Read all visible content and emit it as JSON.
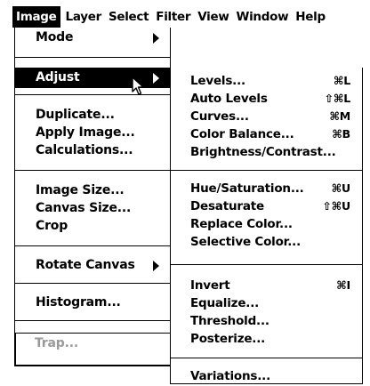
{
  "menubar": {
    "items": [
      "Image",
      "Layer",
      "Select",
      "Filter",
      "View",
      "Window",
      "Help"
    ]
  },
  "image_menu": {
    "mode": "Mode",
    "adjust": "Adjust",
    "duplicate": "Duplicate...",
    "apply_image": "Apply Image...",
    "calculations": "Calculations...",
    "image_size": "Image Size...",
    "canvas_size": "Canvas Size...",
    "crop": "Crop",
    "rotate_canvas": "Rotate Canvas",
    "histogram": "Histogram...",
    "trap": "Trap..."
  },
  "adjust_menu": {
    "levels": "Levels...",
    "levels_sc": "⌘L",
    "auto_levels": "Auto Levels",
    "auto_levels_sc": "⇧⌘L",
    "curves": "Curves...",
    "curves_sc": "⌘M",
    "color_balance": "Color Balance...",
    "color_balance_sc": "⌘B",
    "brightness_contrast": "Brightness/Contrast...",
    "hue_saturation": "Hue/Saturation...",
    "hue_saturation_sc": "⌘U",
    "desaturate": "Desaturate",
    "desaturate_sc": "⇧⌘U",
    "replace_color": "Replace Color...",
    "selective_color": "Selective Color...",
    "invert": "Invert",
    "invert_sc": "⌘I",
    "equalize": "Equalize...",
    "threshold": "Threshold...",
    "posterize": "Posterize...",
    "variations": "Variations..."
  },
  "colors": {
    "highlight_bg": "#000000",
    "highlight_fg": "#ffffff",
    "disabled": "#999999"
  }
}
